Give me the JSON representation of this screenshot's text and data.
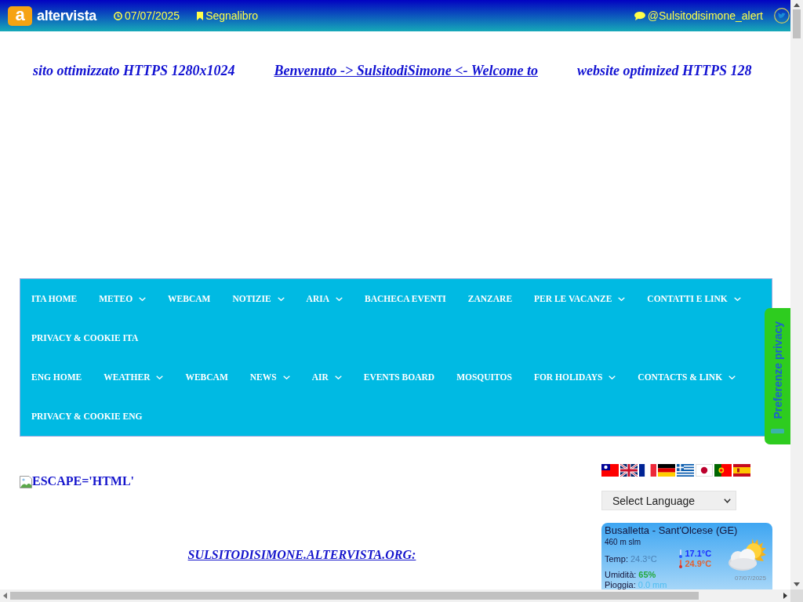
{
  "top_bar": {
    "logo": {
      "mark": "a",
      "text": "altervista"
    },
    "date": "07/07/2025",
    "bookmark": "Segnalibro",
    "social": "@Sulsitodisimone_alert"
  },
  "marquee": [
    {
      "kind": "text",
      "text": "sito ottimizzato HTTPS 1280x1024"
    },
    {
      "kind": "link",
      "text": "Benvenuto -> SulsitodiSimone <- Welcome to"
    },
    {
      "kind": "text",
      "text": "website optimized HTTPS 128"
    }
  ],
  "nav_menus": [
    {
      "items": [
        {
          "label": "ITA HOME",
          "has_submenu": false
        },
        {
          "label": "METEO",
          "has_submenu": true
        },
        {
          "label": "WEBCAM",
          "has_submenu": false
        },
        {
          "label": "NOTIZIE",
          "has_submenu": true
        },
        {
          "label": "ARIA",
          "has_submenu": true
        },
        {
          "label": "BACHECA EVENTI",
          "has_submenu": false
        },
        {
          "label": "ZANZARE",
          "has_submenu": false
        },
        {
          "label": "PER LE VACANZE",
          "has_submenu": true
        },
        {
          "label": "CONTATTI E LINK",
          "has_submenu": true
        },
        {
          "label": "PRIVACY & COOKIE ITA",
          "has_submenu": false
        }
      ]
    },
    {
      "items": [
        {
          "label": "ENG HOME",
          "has_submenu": false
        },
        {
          "label": "WEATHER",
          "has_submenu": true
        },
        {
          "label": "WEBCAM",
          "has_submenu": false
        },
        {
          "label": "NEWS",
          "has_submenu": true
        },
        {
          "label": "AIR",
          "has_submenu": true
        },
        {
          "label": "EVENTS BOARD",
          "has_submenu": false
        },
        {
          "label": "MOSQUITOS",
          "has_submenu": false
        },
        {
          "label": "FOR HOLIDAYS",
          "has_submenu": true
        },
        {
          "label": "CONTACTS & LINK",
          "has_submenu": true
        },
        {
          "label": "PRIVACY & COOKIE ENG",
          "has_submenu": false
        }
      ]
    }
  ],
  "content": {
    "image_alt": "ESCAPE='HTML'",
    "site_link": "SULSITODISIMONE.ALTERVISTA.ORG:"
  },
  "sidebar": {
    "language_select": {
      "value": "Select Language"
    },
    "weather": {
      "location": "Busalletta - Sant'Olcese (GE)",
      "altitude": "460 m slm",
      "rows": [
        {
          "kind": "temp",
          "label": "Temp:",
          "value": "24.3°C"
        },
        {
          "kind": "humidity",
          "label": "Umidità:",
          "value": "65%"
        },
        {
          "kind": "rain",
          "label": "Pioggia:",
          "value": "0.0 mm"
        }
      ],
      "min": "17.1°C",
      "max": "24.9°C",
      "date": "07/07/2025"
    }
  },
  "privacy_tab": {
    "label": "Preferenze privacy"
  }
}
